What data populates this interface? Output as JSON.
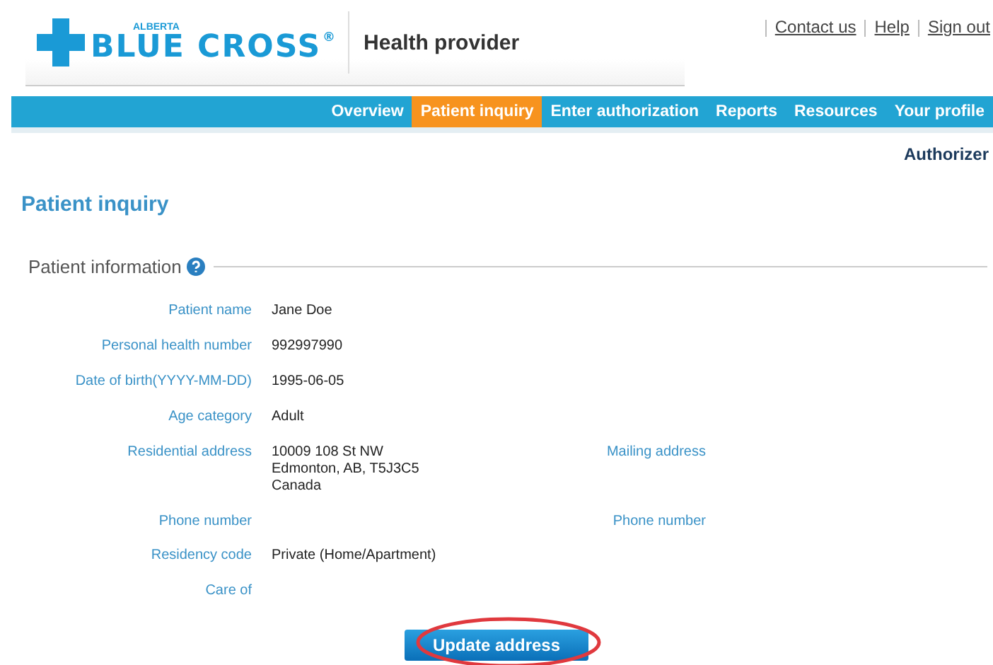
{
  "header": {
    "logo": {
      "small": "ALBERTA",
      "main": "BLUE CROSS",
      "mark": "®"
    },
    "portal": "Health provider",
    "links": [
      "Contact us",
      "Help",
      "Sign out"
    ]
  },
  "nav": [
    {
      "label": "Overview",
      "selected": false
    },
    {
      "label": "Patient inquiry",
      "selected": true
    },
    {
      "label": "Enter authorization",
      "selected": false
    },
    {
      "label": "Reports",
      "selected": false
    },
    {
      "label": "Resources",
      "selected": false
    },
    {
      "label": "Your profile",
      "selected": false
    }
  ],
  "role": "Authorizer",
  "page_title": "Patient inquiry",
  "section": {
    "title": "Patient information",
    "rows": [
      {
        "label": "Patient name",
        "lines": [
          "Jane Doe"
        ]
      },
      {
        "label": "Personal health number",
        "lines": [
          "992997990"
        ]
      },
      {
        "label": "Date of birth(YYYY-MM-DD)",
        "lines": [
          "1995-06-05"
        ]
      },
      {
        "label": "Age category",
        "lines": [
          "Adult"
        ]
      },
      {
        "label": "Residential address",
        "lines": [
          "10009 108 St NW",
          "Edmonton, AB, T5J3C5",
          "Canada"
        ],
        "right_label": "Mailing address"
      },
      {
        "label": "Phone number",
        "right_label": "Phone number"
      },
      {
        "label": "Residency code",
        "lines": [
          "Private (Home/Apartment)"
        ]
      },
      {
        "label": "Care of"
      }
    ]
  },
  "button": {
    "label": "Update address",
    "highlighted": true
  }
}
